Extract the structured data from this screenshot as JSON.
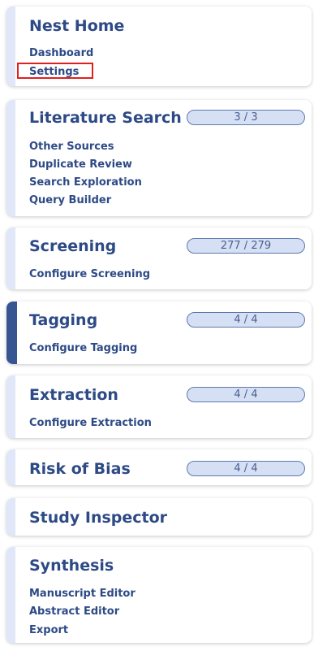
{
  "sections": {
    "home": {
      "title": "Nest Home",
      "links": [
        "Dashboard",
        "Settings"
      ]
    },
    "literature": {
      "title": "Literature Search",
      "progress": "3 / 3",
      "links": [
        "Other Sources",
        "Duplicate Review",
        "Search Exploration",
        "Query Builder"
      ]
    },
    "screening": {
      "title": "Screening",
      "progress": "277 / 279",
      "links": [
        "Configure Screening"
      ]
    },
    "tagging": {
      "title": "Tagging",
      "progress": "4 / 4",
      "links": [
        "Configure Tagging"
      ]
    },
    "extraction": {
      "title": "Extraction",
      "progress": "4 / 4",
      "links": [
        "Configure Extraction"
      ]
    },
    "risk": {
      "title": "Risk of Bias",
      "progress": "4 / 4"
    },
    "inspector": {
      "title": "Study Inspector"
    },
    "synthesis": {
      "title": "Synthesis",
      "links": [
        "Manuscript Editor",
        "Abstract Editor",
        "Export"
      ]
    }
  },
  "colors": {
    "accent_text": "#2d4a86",
    "active_rail": "#375590",
    "inactive_rail": "#dfe7f8",
    "pill_fill": "#d6e0f4",
    "pill_border": "#5f79ad",
    "highlight_box": "#e02020"
  },
  "active_section": "tagging",
  "highlighted_item": "Settings"
}
